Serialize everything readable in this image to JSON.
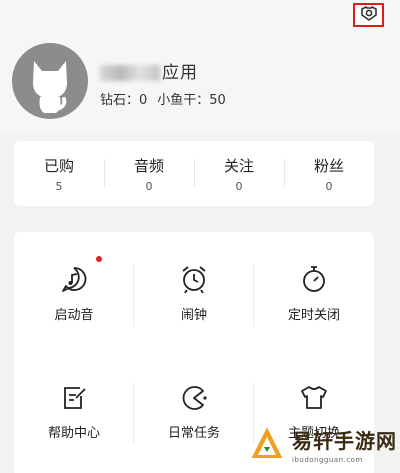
{
  "header": {
    "username_visible": "应用"
  },
  "balances": {
    "diamond": "钻石：0",
    "fish": "小鱼干：50"
  },
  "stats": [
    {
      "label": "已购",
      "value": "5"
    },
    {
      "label": "音频",
      "value": "0"
    },
    {
      "label": "关注",
      "value": "0"
    },
    {
      "label": "粉丝",
      "value": "0"
    }
  ],
  "grid": [
    {
      "label": "启动音",
      "icon": "ringtone-icon",
      "badge": true
    },
    {
      "label": "闹钟",
      "icon": "alarm-clock-icon"
    },
    {
      "label": "定时关闭",
      "icon": "timer-icon"
    },
    {
      "label": "帮助中心",
      "icon": "help-center-icon"
    },
    {
      "label": "日常任务",
      "icon": "daily-task-icon"
    },
    {
      "label": "主题切换",
      "icon": "theme-switch-icon"
    }
  ],
  "watermark": {
    "title": "易轩手游网",
    "subtitle": "ibudongguan.com"
  },
  "colors": {
    "accent_red": "#e01b1b",
    "avatar_gray": "#8c8c8c"
  }
}
